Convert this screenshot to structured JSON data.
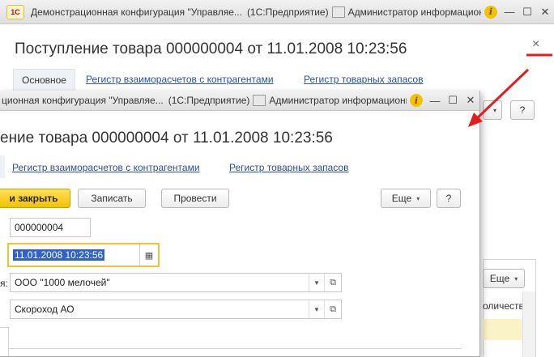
{
  "back_window": {
    "titlebar": {
      "app_title": "Демонстрационная конфигурация \"Управляе...",
      "platform": "(1С:Предприятие)",
      "user": "Администратор информационной"
    },
    "doc_title": "Поступление товара 000000004 от 11.01.2008 10:23:56",
    "tabs": {
      "main": "Основное",
      "reg1": "Регистр взаиморасчетов с контрагентами",
      "reg2": "Регистр товарных запасов"
    },
    "more_label": "Еще",
    "table_header": "оличество"
  },
  "front_window": {
    "titlebar": {
      "app_title": "ционная конфигурация \"Управляе...",
      "platform": "(1С:Предприятие)",
      "user": "Администратор информационной"
    },
    "doc_title": "ение товара 000000004 от 11.01.2008 10:23:56",
    "tabs": {
      "reg1": "Регистр взаиморасчетов с контрагентами",
      "reg2": "Регистр товарных запасов"
    },
    "toolbar": {
      "post_close": "и закрыть",
      "save": "Записать",
      "post": "Провести",
      "more": "Еще",
      "help": "?"
    },
    "form": {
      "number": "000000004",
      "date": "11.01.2008 10:23:56",
      "org_label": "я:",
      "org_value": "ООО \"1000 мелочей\"",
      "contractor_value": "Скороход АО"
    }
  },
  "colors": {
    "accent_yellow": "#f2c200",
    "link_blue": "#2b4fa3",
    "arrow_red": "#e31e1e"
  }
}
